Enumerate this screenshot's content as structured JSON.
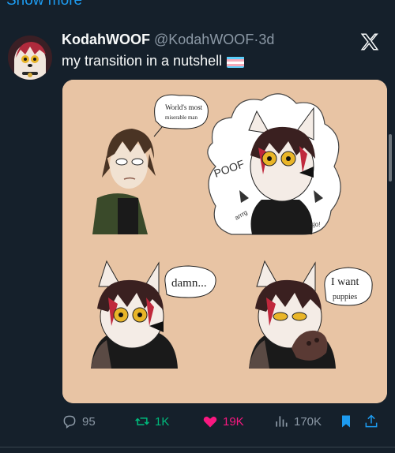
{
  "show_more": "Show more",
  "author": {
    "display_name": "KodahWOOF",
    "handle": "@KodahWOOF",
    "separator": "·",
    "time": "3d"
  },
  "tweet": {
    "text": "my transition in a nutshell"
  },
  "comic": {
    "panel1_caption": "World's most miserable man",
    "panel2_effect": "POOF",
    "panel2_sfx_left": "arrrg",
    "panel2_sfx_right": "sjo!",
    "panel3_speech": "damn...",
    "panel4_speech_line1": "I want",
    "panel4_speech_line2": "puppies"
  },
  "actions": {
    "replies": "95",
    "reposts": "1K",
    "likes": "19K",
    "views": "170K"
  },
  "colors": {
    "background": "#15202b",
    "accent": "#1d9bf0",
    "repost": "#00ba7c",
    "like": "#f91880",
    "muted": "#8b98a5",
    "comic_bg": "#e8c4a4"
  },
  "icons": [
    "x-logo-icon",
    "trans-flag-icon",
    "reply-icon",
    "repost-icon",
    "heart-icon",
    "views-icon",
    "bookmark-icon",
    "share-icon"
  ]
}
